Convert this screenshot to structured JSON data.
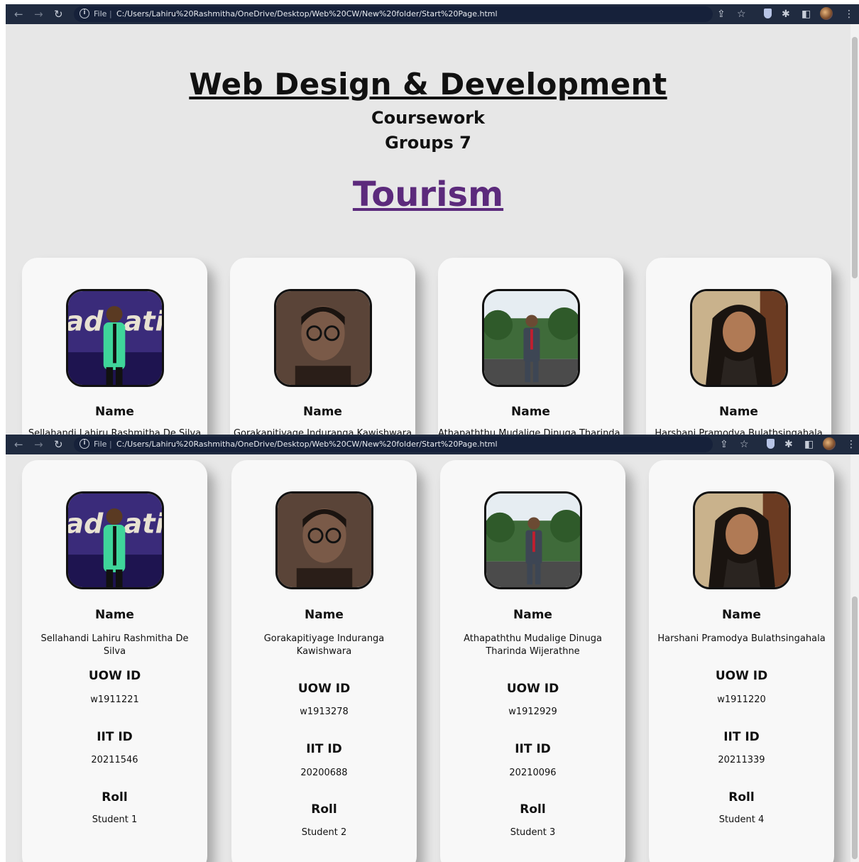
{
  "browser": {
    "file_label": "File",
    "url": "C:/Users/Lahiru%20Rashmitha/OneDrive/Desktop/Web%20CW/New%20folder/Start%20Page.html"
  },
  "page": {
    "title": "Web Design & Development",
    "subtitle_1": "Coursework",
    "subtitle_2": "Groups 7",
    "topic": "Tourism"
  },
  "labels": {
    "name": "Name",
    "uow_id": "UOW ID",
    "iit_id": "IIT ID",
    "roll": "Roll"
  },
  "members": [
    {
      "name": "Sellahandi Lahiru Rashmitha De Silva",
      "uow_id": "w1911221",
      "iit_id": "20211546",
      "roll": "Student 1",
      "photo_icon": "graduation-stage-portrait"
    },
    {
      "name": "Gorakapitiyage Induranga Kawishwara",
      "uow_id": "w1913278",
      "iit_id": "20200688",
      "roll": "Student 2",
      "photo_icon": "selfie-portrait"
    },
    {
      "name": "Athapaththu Mudalige Dinuga Tharinda Wijerathne",
      "uow_id": "w1912929",
      "iit_id": "20210096",
      "roll": "Student 3",
      "photo_icon": "outdoor-suit-portrait"
    },
    {
      "name": "Harshani Pramodya Bulathsingahala",
      "uow_id": "w1911220",
      "iit_id": "20211339",
      "roll": "Student 4",
      "photo_icon": "outdoor-portrait"
    }
  ],
  "colors": {
    "topic": "#5c2a7c",
    "chrome_bar": "#202b40",
    "page_bg": "#e7e7e7",
    "card_bg": "#f8f8f8"
  }
}
